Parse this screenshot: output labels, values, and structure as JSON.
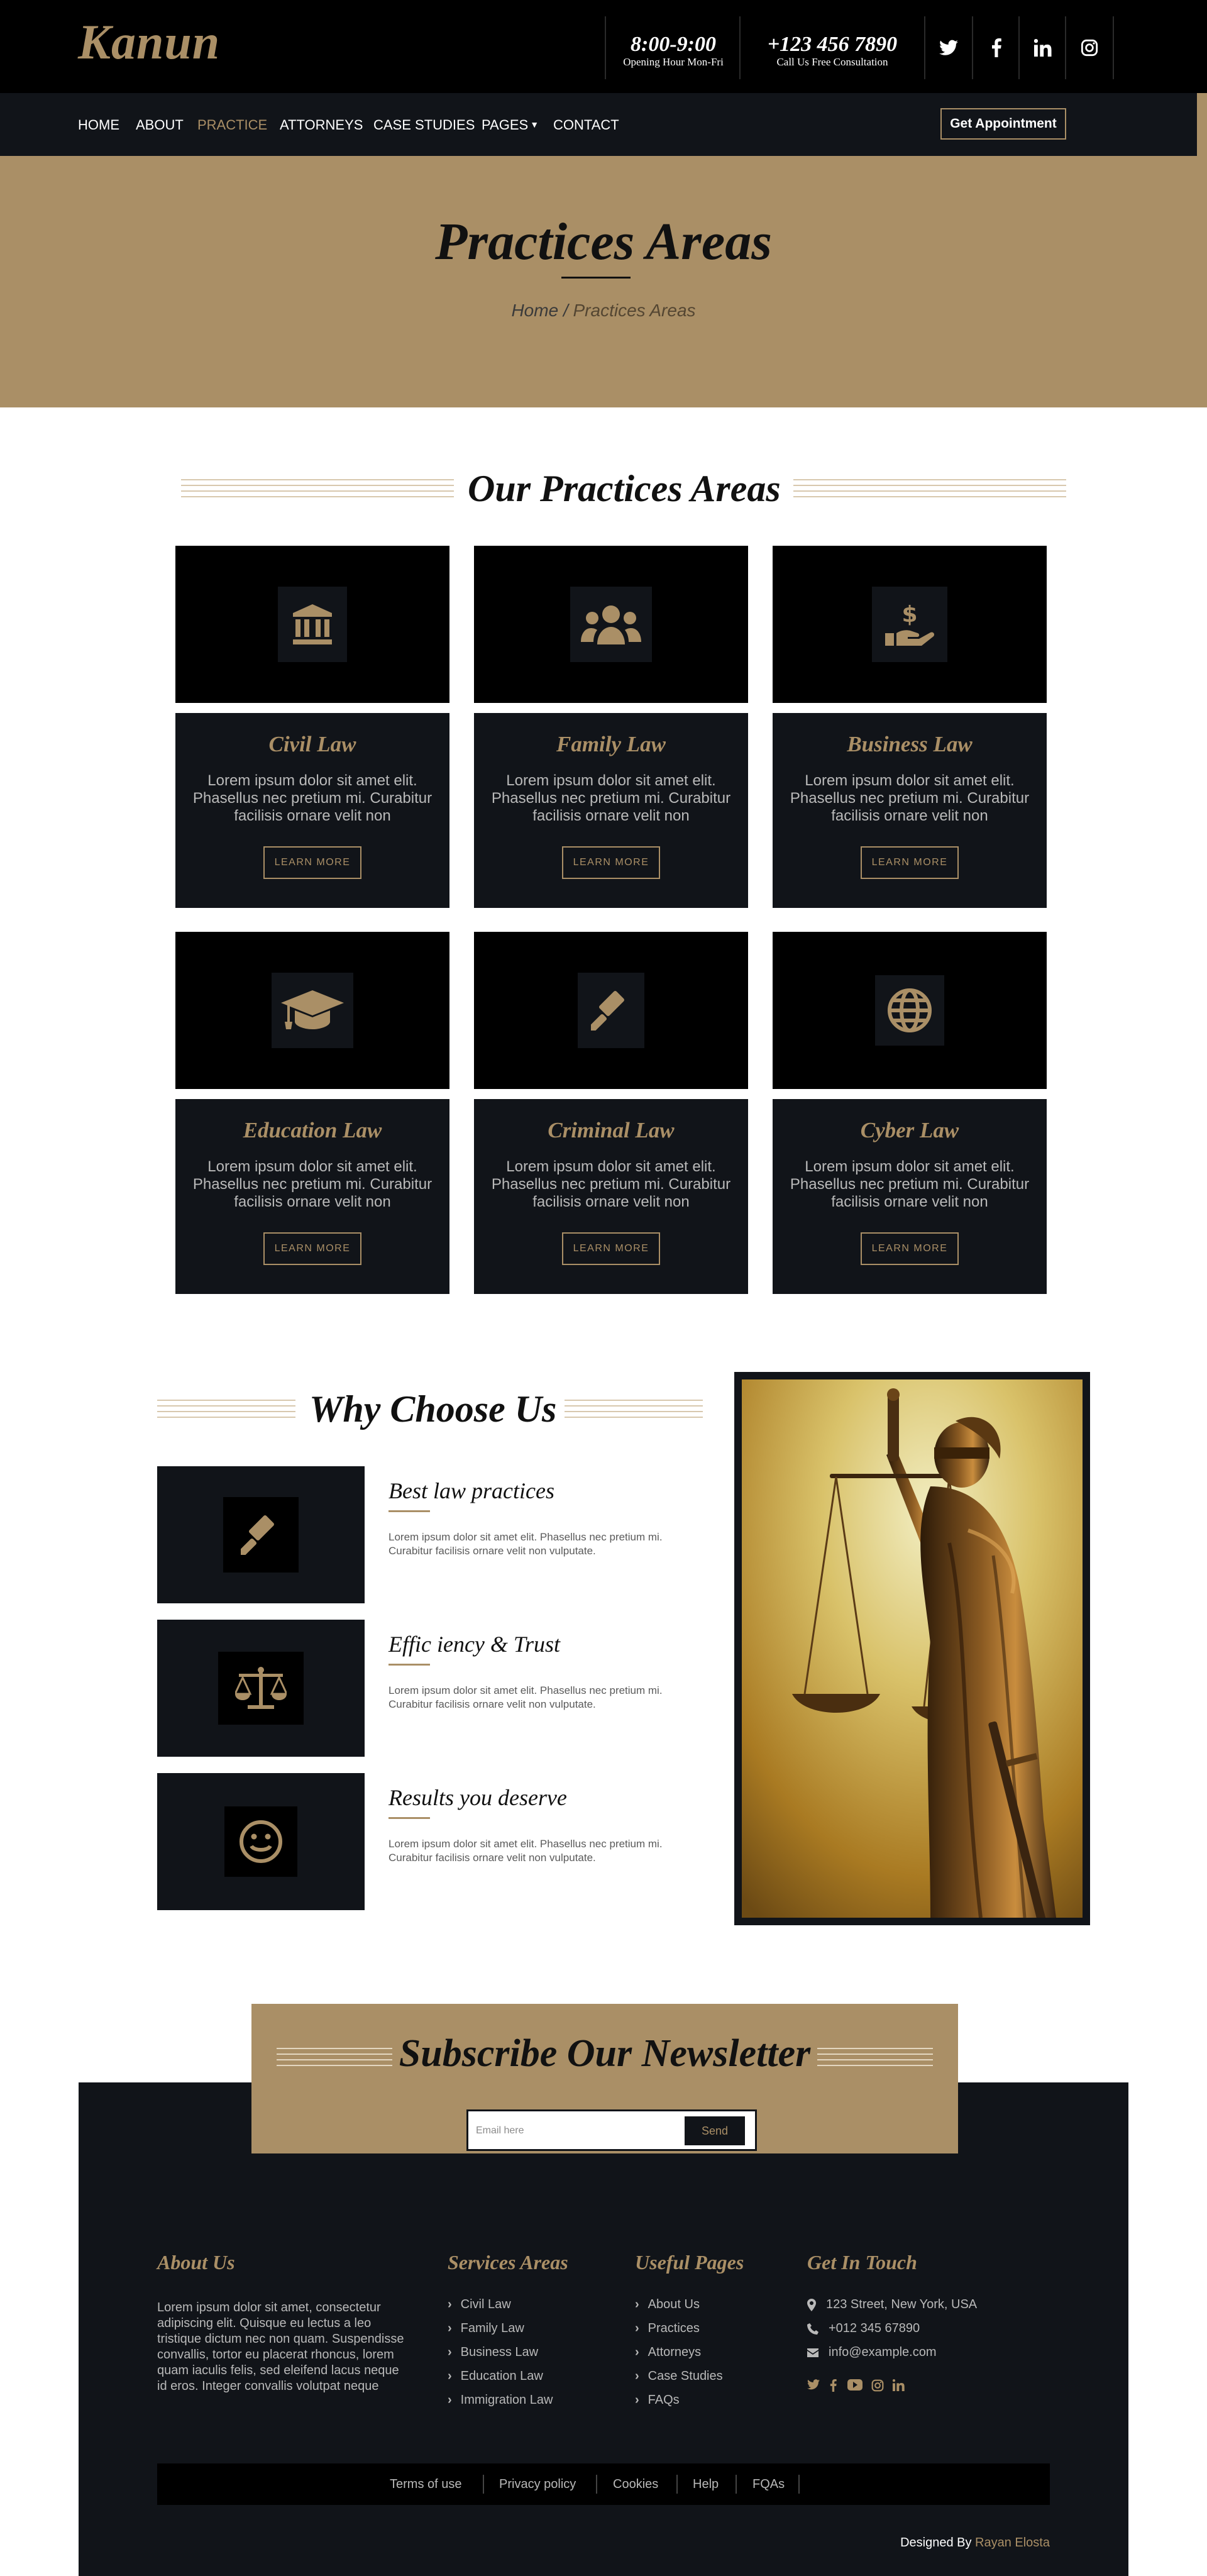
{
  "brand": {
    "logo": "Kanun",
    "accent_color": "#aa8f66",
    "dark_color": "#111419"
  },
  "topbar": {
    "hours": {
      "value": "8:00-9:00",
      "label": "Opening Hour Mon-Fri"
    },
    "phone": {
      "value": "+123 456 7890",
      "label": "Call Us Free Consultation"
    },
    "social_icons": [
      "twitter-icon",
      "facebook-icon",
      "linkedin-icon",
      "instagram-icon"
    ]
  },
  "nav": {
    "items": [
      "HOME",
      "ABOUT",
      "PRACTICE",
      "ATTORNEYS",
      "CASE STUDIES",
      "PAGES",
      "CONTACT"
    ],
    "active": "PRACTICE",
    "cta": "Get Appointment"
  },
  "page_header": {
    "title": "Practices Areas",
    "breadcrumb": {
      "home": "Home",
      "separator": "/",
      "current": "Practices Areas"
    }
  },
  "practices": {
    "title": "Our Practices Areas",
    "button_label": "LEARN MORE",
    "items": [
      {
        "icon": "bank-icon",
        "title": "Civil Law",
        "text": "Lorem ipsum dolor sit amet elit. Phasellus nec pretium mi. Curabitur facilisis ornare velit non"
      },
      {
        "icon": "users-icon",
        "title": "Family Law",
        "text": "Lorem ipsum dolor sit amet elit. Phasellus nec pretium mi. Curabitur facilisis ornare velit non"
      },
      {
        "icon": "hand-dollar-icon",
        "title": "Business Law",
        "text": "Lorem ipsum dolor sit amet elit. Phasellus nec pretium mi. Curabitur facilisis ornare velit non"
      },
      {
        "icon": "graduation-cap-icon",
        "title": "Education Law",
        "text": "Lorem ipsum dolor sit amet elit. Phasellus nec pretium mi. Curabitur facilisis ornare velit non"
      },
      {
        "icon": "gavel-icon",
        "title": "Criminal Law",
        "text": "Lorem ipsum dolor sit amet elit. Phasellus nec pretium mi. Curabitur facilisis ornare velit non"
      },
      {
        "icon": "globe-icon",
        "title": "Cyber Law",
        "text": "Lorem ipsum dolor sit amet elit. Phasellus nec pretium mi. Curabitur facilisis ornare velit non"
      }
    ]
  },
  "why": {
    "title": "Why Choose Us",
    "items": [
      {
        "icon": "gavel-icon",
        "title": "Best law practices",
        "text": "Lorem ipsum dolor sit amet elit. Phasellus nec pretium mi. Curabitur facilisis ornare velit non vulputate."
      },
      {
        "icon": "scale-icon",
        "title": "Effic iency & Trust",
        "text": "Lorem ipsum dolor sit amet elit. Phasellus nec pretium mi. Curabitur facilisis ornare velit non vulputate."
      },
      {
        "icon": "smile-icon",
        "title": "Results you deserve",
        "text": "Lorem ipsum dolor sit amet elit. Phasellus nec pretium mi. Curabitur facilisis ornare velit non vulputate."
      }
    ]
  },
  "newsletter": {
    "title": "Subscribe Our Newsletter",
    "placeholder": "Email here",
    "button": "Send"
  },
  "footer": {
    "about": {
      "title": "About Us",
      "text": "Lorem ipsum dolor sit amet, consectetur adipiscing elit. Quisque eu lectus a leo tristique dictum nec non quam. Suspendisse convallis, tortor eu placerat rhoncus, lorem quam iaculis felis, sed eleifend lacus neque id eros. Integer convallis volutpat neque"
    },
    "services": {
      "title": "Services Areas",
      "links": [
        "Civil Law",
        "Family Law",
        "Business Law",
        "Education Law",
        "Immigration Law"
      ]
    },
    "useful": {
      "title": "Useful Pages",
      "links": [
        "About Us",
        "Practices",
        "Attorneys",
        "Case Studies",
        "FAQs"
      ]
    },
    "contact": {
      "title": "Get In Touch",
      "address": "123 Street, New York, USA",
      "phone": "+012 345 67890",
      "email": "info@example.com"
    },
    "bottom_links": [
      "Terms of use",
      "Privacy policy",
      "Cookies",
      "Help",
      "FQAs"
    ],
    "credit": {
      "label": "Designed By",
      "author": "Rayan Elosta"
    }
  }
}
